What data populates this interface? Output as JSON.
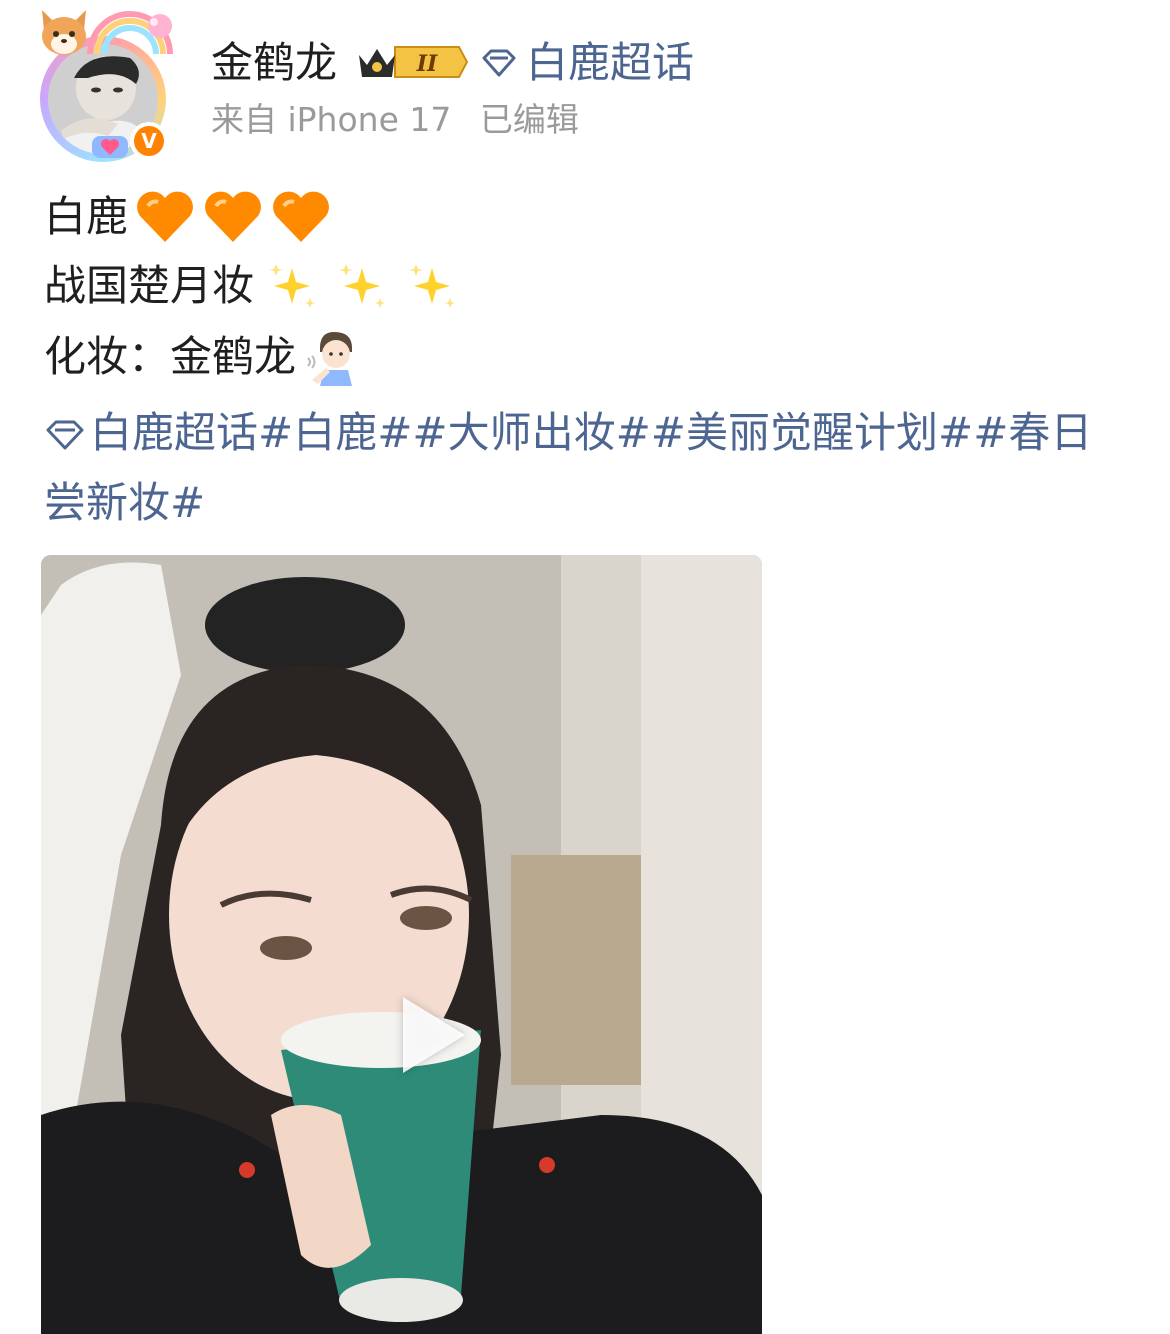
{
  "post": {
    "author": {
      "name": "金鹤龙",
      "verified_badge": "V",
      "level_badge": "II"
    },
    "topic_link": "白鹿超话",
    "meta": {
      "source": "来自 iPhone 17",
      "edited": "已编辑"
    },
    "lines": {
      "line1_text": "白鹿",
      "line2_text": "战国楚月妆",
      "line3_text": "化妆：金鹤龙"
    },
    "emojis": {
      "line1": [
        "orange-heart",
        "orange-heart",
        "orange-heart"
      ],
      "line2": [
        "sparkles",
        "sparkles",
        "sparkles"
      ],
      "line3": [
        "person-gesturing"
      ]
    },
    "hashtags": {
      "topic": "白鹿超话",
      "items": [
        "#白鹿#",
        "#大师出妆#",
        "#美丽觉醒计划#",
        "#春日尝新妆#"
      ]
    },
    "media": {
      "type": "video",
      "icon": "play-icon"
    }
  },
  "colors": {
    "link": "#4d6691",
    "meta_text": "#9a9a9a",
    "verify_orange": "#ff8200",
    "heart_orange": "#ff8a00",
    "sparkle_yellow": "#ffd12b"
  }
}
